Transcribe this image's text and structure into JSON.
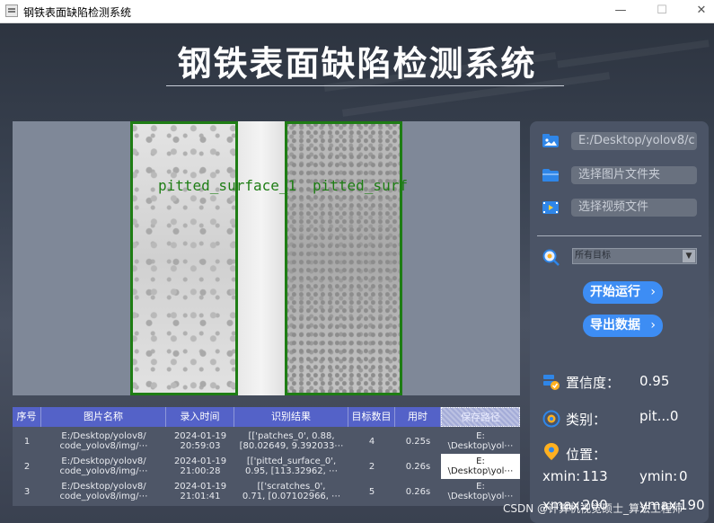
{
  "window": {
    "title": "钢铁表面缺陷检测系统",
    "controls": [
      "—",
      "☐",
      "✕"
    ]
  },
  "header": {
    "title": "钢铁表面缺陷检测系统"
  },
  "detections": [
    {
      "label": "pitted_surface_1"
    },
    {
      "label": "pitted_surf"
    }
  ],
  "sidebar": {
    "image_path": "E:/Desktop/yolov8/c",
    "folder_placeholder": "选择图片文件夹",
    "video_placeholder": "选择视频文件",
    "target_select": "所有目标",
    "start_button": "开始运行",
    "export_button": "导出数据",
    "confidence": {
      "label": "置信度：",
      "value": "0.95"
    },
    "category": {
      "label": "类别：",
      "value": "pit...0"
    },
    "position": {
      "label": "位置：",
      "xmin_label": "xmin:",
      "xmin_value": "113",
      "ymin_label": "ymin:",
      "ymin_value": "0",
      "xmax_label": "xmax:",
      "xmax_value": "200",
      "ymax_label": "ymax:",
      "ymax_value": "190"
    }
  },
  "table": {
    "headers": [
      "序号",
      "图片名称",
      "录入时间",
      "识别结果",
      "目标数目",
      "用时",
      "保存路径"
    ],
    "rows": [
      {
        "index": "1",
        "name": "E:/Desktop/yolov8/\ncode_yolov8/img/⋯",
        "time": "2024-01-19\n20:59:03",
        "result": "[['patches_0', 0.88,\n[80.02649, 9.392033⋯",
        "count": "4",
        "duration": "0.25s",
        "path": "E:\n\\Desktop\\yol⋯"
      },
      {
        "index": "2",
        "name": "E:/Desktop/yolov8/\ncode_yolov8/img/⋯",
        "time": "2024-01-19\n21:00:28",
        "result": "[['pitted_surface_0',\n0.95, [113.32962, ⋯",
        "count": "2",
        "duration": "0.26s",
        "path": "E:\n\\Desktop\\yol⋯"
      },
      {
        "index": "3",
        "name": "E:/Desktop/yolov8/\ncode_yolov8/img/⋯",
        "time": "2024-01-19\n21:01:41",
        "result": "[['scratches_0',\n0.71, [0.07102966, ⋯",
        "count": "5",
        "duration": "0.26s",
        "path": "E:\n\\Desktop\\yol⋯"
      }
    ]
  },
  "watermark": "CSDN @计算机视觉硕士_算法工程师",
  "colors": {
    "accent": "#3d8df4",
    "header_blue": "#5462c8",
    "detection_green": "#1e7d14"
  }
}
